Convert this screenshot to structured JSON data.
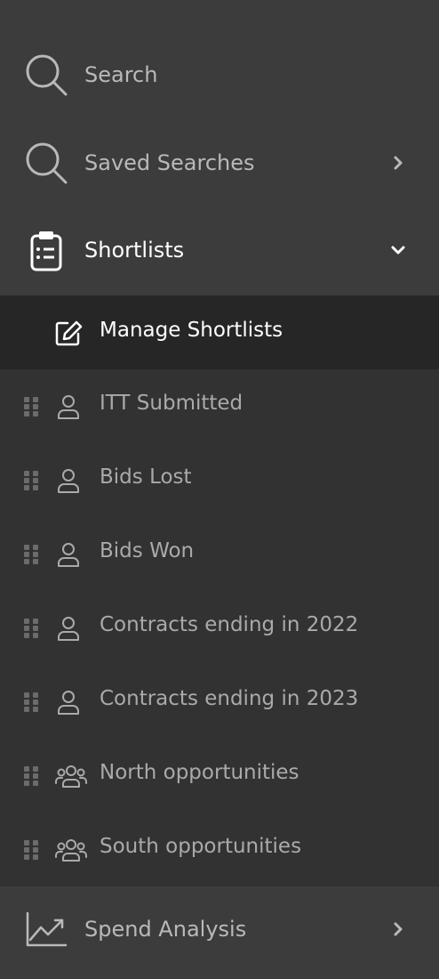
{
  "nav": {
    "search": {
      "label": "Search",
      "icon": "search-icon"
    },
    "saved_searches": {
      "label": "Saved Searches",
      "icon": "search-icon"
    },
    "shortlists": {
      "label": "Shortlists",
      "icon": "clipboard-list-icon",
      "expanded": true
    },
    "manage_shortlists": {
      "label": "Manage Shortlists",
      "icon": "edit-icon"
    },
    "shortlist_items": [
      {
        "label": "ITT Submitted",
        "icon": "user-icon"
      },
      {
        "label": "Bids Lost",
        "icon": "user-icon"
      },
      {
        "label": "Bids Won",
        "icon": "user-icon"
      },
      {
        "label": "Contracts ending in 2022",
        "icon": "user-icon"
      },
      {
        "label": "Contracts ending in 2023",
        "icon": "user-icon"
      },
      {
        "label": "North opportunities",
        "icon": "users-icon"
      },
      {
        "label": "South opportunities",
        "icon": "users-icon"
      }
    ],
    "spend_analysis": {
      "label": "Spend Analysis",
      "icon": "trending-chart-icon"
    }
  },
  "colors": {
    "sidebar_bg": "#3c3c3c",
    "submenu_bg": "#323232",
    "active_bg": "#262626",
    "text_muted": "#b9b9b9",
    "text_active": "#ffffff"
  }
}
